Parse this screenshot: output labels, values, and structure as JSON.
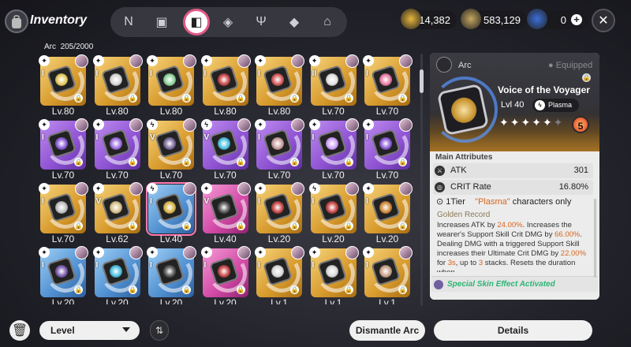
{
  "header": {
    "title": "Inventory",
    "nav_tabs": [
      {
        "icon": "n-logo-icon",
        "glyph": "N"
      },
      {
        "icon": "device-icon",
        "glyph": "▣"
      },
      {
        "icon": "arc-book-icon",
        "glyph": "◧",
        "active": true
      },
      {
        "icon": "cube-icon",
        "glyph": "◈"
      },
      {
        "icon": "food-icon",
        "glyph": "Ψ"
      },
      {
        "icon": "box-icon",
        "glyph": "◆"
      },
      {
        "icon": "home-icon",
        "glyph": "⌂"
      }
    ],
    "currencies": [
      {
        "icon": "gold-coin-icon",
        "value": "14,382",
        "color": "#e8b63a"
      },
      {
        "icon": "ticket-icon",
        "value": "583,129",
        "color": "#c7a760"
      },
      {
        "icon": "crystal-icon",
        "value": "0",
        "color": "#3b6fd9"
      }
    ]
  },
  "inventory": {
    "label": "Arc",
    "count": "205/2000",
    "items": [
      {
        "level": "Lv.80",
        "tier": "I",
        "rarity": "gold",
        "element": "✦",
        "color": "#e7c95e"
      },
      {
        "level": "Lv.80",
        "tier": "I",
        "rarity": "gold",
        "element": "✦",
        "color": "#d6d6d6"
      },
      {
        "level": "Lv.80",
        "tier": "I",
        "rarity": "gold",
        "element": "✦",
        "color": "#8fd39a"
      },
      {
        "level": "Lv.80",
        "tier": "I",
        "rarity": "gold",
        "element": "✦",
        "color": "#c74545"
      },
      {
        "level": "Lv.80",
        "tier": "I",
        "rarity": "gold",
        "element": "✦",
        "color": "#d65a5a"
      },
      {
        "level": "Lv.70",
        "tier": "II",
        "rarity": "gold",
        "element": "✦",
        "color": "#e0e0e0"
      },
      {
        "level": "Lv.70",
        "tier": "I",
        "rarity": "gold",
        "element": "✦",
        "color": "#e87aa4"
      },
      {
        "level": "Lv.70",
        "tier": "I",
        "rarity": "purple",
        "element": "✦",
        "color": "#8a5ad8"
      },
      {
        "level": "Lv.70",
        "tier": "I",
        "rarity": "purple",
        "element": "✦",
        "color": "#9c6ee0"
      },
      {
        "level": "Lv.70",
        "tier": "V",
        "rarity": "gold",
        "element": "ϟ",
        "color": "#7a6a9a"
      },
      {
        "level": "Lv.70",
        "tier": "V",
        "rarity": "purple",
        "element": "ϟ",
        "color": "#4ac0e0"
      },
      {
        "level": "Lv.70",
        "tier": "I",
        "rarity": "purple",
        "element": "✦",
        "color": "#c9a0a0"
      },
      {
        "level": "Lv.70",
        "tier": "I",
        "rarity": "purple",
        "element": "✦",
        "color": "#d0a0ff"
      },
      {
        "level": "Lv.70",
        "tier": "I",
        "rarity": "purple",
        "element": "✦",
        "color": "#8a5ad8"
      },
      {
        "level": "Lv.70",
        "tier": "I",
        "rarity": "gold",
        "element": "✦",
        "color": "#c0c0c0"
      },
      {
        "level": "Lv.62",
        "tier": "V",
        "rarity": "gold",
        "element": "✦",
        "color": "#d9c08a"
      },
      {
        "level": "Lv.40",
        "tier": "I",
        "rarity": "blue",
        "element": "ϟ",
        "color": "#d8b54a",
        "selected": true
      },
      {
        "level": "Lv.40",
        "tier": "V",
        "rarity": "pink",
        "element": "✦",
        "color": "#555"
      },
      {
        "level": "Lv.20",
        "tier": "I",
        "rarity": "gold",
        "element": "✦",
        "color": "#c74545"
      },
      {
        "level": "Lv.20",
        "tier": "I",
        "rarity": "gold",
        "element": "ϟ",
        "color": "#c74545"
      },
      {
        "level": "Lv.20",
        "tier": "I",
        "rarity": "gold",
        "element": "✦",
        "color": "#d08a3a"
      },
      {
        "level": "Lv.20",
        "tier": "I",
        "rarity": "blue",
        "element": "✦",
        "color": "#7a5ab0"
      },
      {
        "level": "Lv.20",
        "tier": "I",
        "rarity": "blue",
        "element": "✦",
        "color": "#4ac0e0"
      },
      {
        "level": "Lv.20",
        "tier": "I",
        "rarity": "blue",
        "element": "✦",
        "color": "#555"
      },
      {
        "level": "Lv.20",
        "tier": "I",
        "rarity": "pink",
        "element": "✦",
        "color": "#c74545"
      },
      {
        "level": "Lv.1",
        "tier": "I",
        "rarity": "gold",
        "element": "✦",
        "color": "#d9d9d9"
      },
      {
        "level": "Lv.1",
        "tier": "I",
        "rarity": "gold",
        "element": "✦",
        "color": "#d9d9d9"
      },
      {
        "level": "Lv.1",
        "tier": "I",
        "rarity": "gold",
        "element": "✦",
        "color": "#c9a088"
      }
    ]
  },
  "detail": {
    "type": "Arc",
    "equipped_label": "Equipped",
    "name": "Voice of the Voyager",
    "level": "Lvl 40",
    "element_glyph": "ϟ",
    "element": "Plasma",
    "stars_filled": 5,
    "stars_total": 6,
    "rank": "5",
    "main_attributes_label": "Main Attributes",
    "attributes": [
      {
        "name": "ATK",
        "value": "301",
        "icon": "atk-icon"
      },
      {
        "name": "CRIT Rate",
        "value": "16.80%",
        "icon": "crit-icon"
      }
    ],
    "tier_label": "1Tier",
    "tier_element": "\"Plasma\"",
    "tier_suffix": " characters only",
    "record_title": "Golden Record",
    "description_parts": [
      {
        "text": "Increases ATK by ",
        "hl": false
      },
      {
        "text": "24.00%",
        "hl": true
      },
      {
        "text": ". Increases the wearer's Support Skill Crit DMG by ",
        "hl": false
      },
      {
        "text": "66.00%",
        "hl": true
      },
      {
        "text": ". Dealing DMG with a triggered Support Skill increases their Ultimate Crit DMG by ",
        "hl": false
      },
      {
        "text": "22.00%",
        "hl": true
      },
      {
        "text": " for ",
        "hl": false
      },
      {
        "text": "3s",
        "hl": true
      },
      {
        "text": ", up to ",
        "hl": false
      },
      {
        "text": "3",
        "hl": true
      },
      {
        "text": " stacks. Resets the duration when",
        "hl": false
      }
    ],
    "special_effect": "Special Skin Effect Activated"
  },
  "footer": {
    "sort_label": "Level",
    "dismantle_label": "Dismantle Arc",
    "details_label": "Details"
  }
}
